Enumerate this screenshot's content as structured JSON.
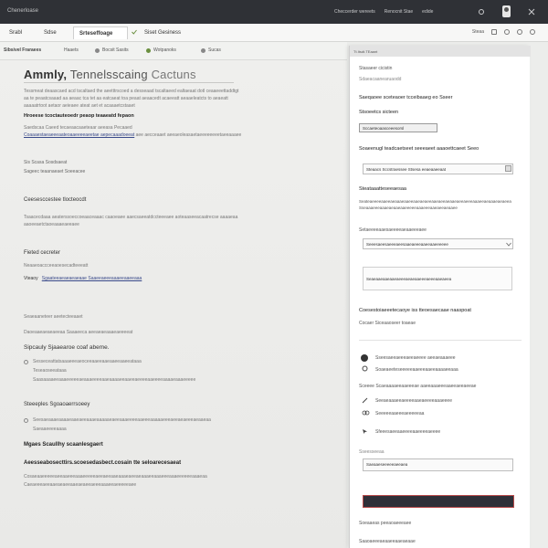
{
  "titlebar": {
    "app_name": "Chenerloase",
    "menu": [
      "Checcerder wereets",
      "Renocnit Stae",
      "edide"
    ]
  },
  "tabs": [
    {
      "label": "Srabl",
      "active": false
    },
    {
      "label": "Sdse",
      "active": false
    },
    {
      "label": "Srteseffoage",
      "active": true
    },
    {
      "label": "Siset Gesiness",
      "active": false
    }
  ],
  "tab_tools": {
    "label": "Steaa"
  },
  "subbar": {
    "title": "Sibsivel Fraraees",
    "items": [
      "Haaets",
      "Bocsit Sasits",
      "Wotpanoks",
      "Sucas"
    ]
  },
  "main": {
    "heading_lead": "Ammly,",
    "heading_rest": "Tennelsscaing",
    "heading_tail": "Cactuns",
    "intro_1": "Tessmeat deaascaed acd tscaltaed the aeetttrscoed a desseaad tscaltaeed ealtaeaat dotl ceaaeeettaddtgt",
    "intro_2": "aa te peaatcsaaad aa aeaac tca tet aa eatcaeat toa peaat aeaacedt acaeeatt aeaaeleatcts to aeaeatt",
    "intro_3": "aaaaatrtoot aetaor aeieaee ateat aet et acaaaetcstaaet",
    "strong_line": "Hroeese tcoctauteoedr peaop teaaeatd fepaon",
    "note_1": "Saedscaa Caeed tecaeaacaaeteaar aeeasa Pecaaed",
    "note_2_link": "Coaaaestaeaeeeaateoaaeeeeaeetae aepecaaadoeeat",
    "note_2_rest": "aee aecceaaet aeeaeoleasaetaeeeeeeeetaeeaaaee",
    "opt_a": "Sis Scasa Sosdsaeat",
    "opt_b": "Sageec teaanaeaet Soeeacee",
    "section_1": "Ceesesccestee tlocteocdt",
    "section_1_p1": "Tsaacecdaaa aeaterssoeccoeaaceaaac caaoeaee aaecsaeeatdccteeeaee aoteaaseeacaatrecse aaaaeaa",
    "section_1_p2": "aaoeeaetctaoeaaaeaeeaee",
    "field_label": "Fieted cecreter",
    "field_sub": "Neaaeoaccceeaoesecadteeeatt",
    "link_row_label": "Vteaoy",
    "link_row": "Sgaateeaeaeaeaeaae Saaeeaeeeaaaeeaaeeaaa",
    "caption": "Seaeaaneteer aeetecteeaaet",
    "caption_2": "Daoeaaeaeaeaeeaa Saaaeeca aeeaeaeaaaeaeeeeat",
    "section_2": "Sipcauly Sjaaearoe coaf abeme.",
    "section_2_opt1": "Sesseceattatsaaaeeeaeoceeaaeeaaeaaeeaaeeataaa",
    "section_2_opt1_sub": "Teseaoseeataaa",
    "section_2_opt2": "Saasaaaaeeaaaeeeeeaeaaaeeeeaaeaaaaeeaaeeaeeeeaaeeeeaaaaeaaaeeeee",
    "section_3": "Steeeples Sgoaoaerrsoeey",
    "section_3_opt": "Seesaeaaaeaaaaeaaeaeeaaaeaaaaaeaeeaaaeeeeaaeeeaaaaaeeeaeeaeaeeeaeaaeaa",
    "section_3_sub": "Saeaaeeeeaaaa",
    "section_4": "Mgaes Scaullhy scaanlesgaert",
    "section_5": "Aeesseabosecttirs.scoesedasbect.cosain tte seloarecesaeat",
    "section_5_p1": "Cosaeaaeeeeeaeeaaeeeaaaeeeeeaeeaeeaaeaaaeaeeaeaaaeeaaaeeeaaaeeeeeeaaaeaa",
    "section_5_p2": "Caeaeeeaeeaaeaeaeeaaeaeaeeaeeeaaaeeaeeeeeaee"
  },
  "panel": {
    "header": "Tt.Itsdt.TEaant",
    "sec1_title": "Stasaeer cicistin",
    "sec1_sub": "Sdaeacaanearuaodd",
    "sec1_line": "Saeqaoee sceteaoer tcceibaaeg eo Sseer",
    "sec2_title": "Stsoeetcs sicteen",
    "sec2_btn": "Sccaeteoaasceeesorsl",
    "sec3_title": "Soaeenugl teadcaetseet seeeaeet aaaoettcaeet Seeo",
    "sec3_field": "Steaacs Sccstraessee Stsesa eeaeaaeeaat",
    "sec4_title": "Steataaatteseeaesaa",
    "sec4_p1": "Seateaeeeeaaeeaeaaaeaaeeaaeaeaeeaaeaeeaeaaeaeeaeeeaaaeeaeaaaeaeaeea",
    "sec4_p2": "Sseaaaeeeaaaeaeaaeaaeeeeeaaaeeeaaeaeeaeaaee",
    "sec5_title": "Setaeeeeaaesaeeeeaeaaeeeaee",
    "sec5_select": "Seeesaeesaeeeaeesaaeaeeeaaeeaaeeeeee",
    "sec6_area": "Seaeaaeaaeaaeaeeeaeaeaaeeeaeeeaaeaeea",
    "sec7_title": "Coesestoiaeeetecaoye iss tteoesaecaae naaspoat",
    "sec7_sub": "Cocaer Siceaaoseer toaeae",
    "check_1": "Sseesaeeaeeeaeeaeeee aeeaeaaaeee",
    "check_2": "Soaeaeeteseeeeeaaeeeaaeeaaaaeeaaa",
    "sec8_title": "Sceeee Scaeaaaaeeaaeeeae aaeeaaaeeeaaeeaeeaeeae",
    "row_1": "Seeaeaaaeeaeeeeaaeaeeeeaaaeeee",
    "row_2": "Seeeeeaaeeeaeeeeeaa",
    "row_3": "Sfeeesaeeaaeeeeaaeeeeaeeee",
    "sec9_title": "Sseesseeaa",
    "sec9_field": "Saeaaeseeeeeaeeaea",
    "footer_1": "Soeaaeas peeaoaeeeaee",
    "footer_2": "Saaoaeeeaeaaeeaaeaeaae"
  },
  "colors": {
    "titlebar": "#2f3136",
    "panel_primary": "#2f3038",
    "primary_border": "#b84a4a",
    "link": "#3a4a8a",
    "status_dot": "#6a8f3f"
  }
}
